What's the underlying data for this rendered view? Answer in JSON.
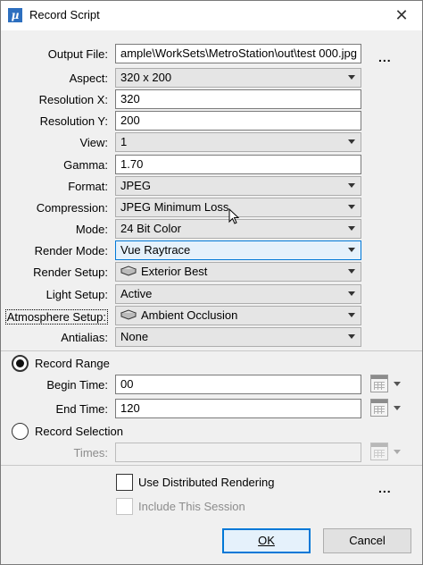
{
  "window": {
    "title": "Record Script",
    "app_icon": "microstation-icon",
    "close_glyph": "✕"
  },
  "labels": {
    "output_file": "Output File:",
    "aspect": "Aspect:",
    "resolution_x": "Resolution X:",
    "resolution_y": "Resolution Y:",
    "view": "View:",
    "gamma": "Gamma:",
    "format": "Format:",
    "compression": "Compression:",
    "mode": "Mode:",
    "render_mode": "Render Mode:",
    "render_setup": "Render Setup:",
    "light_setup": "Light Setup:",
    "atmosphere_setup": "Atmosphere Setup:",
    "antialias": "Antialias:"
  },
  "values": {
    "output_file": "ample\\WorkSets\\MetroStation\\out\\test 000.jpg",
    "aspect": "320 x 200",
    "resolution_x": "320",
    "resolution_y": "200",
    "view": "1",
    "gamma": "1.70",
    "format": "JPEG",
    "compression": "JPEG Minimum Loss",
    "mode": "24 Bit Color",
    "render_mode": "Vue Raytrace",
    "render_setup": "Exterior Best",
    "light_setup": "Active",
    "atmosphere_setup": "Ambient Occlusion",
    "antialias": "None"
  },
  "browse_label": "...",
  "record_range": {
    "label": "Record Range",
    "selected": true,
    "begin_label": "Begin Time:",
    "begin_value": "00",
    "end_label": "End Time:",
    "end_value": "120"
  },
  "record_selection": {
    "label": "Record Selection",
    "selected": false,
    "times_label": "Times:",
    "times_value": ""
  },
  "options": {
    "distributed_label": "Use Distributed Rendering",
    "include_session_label": "Include This Session",
    "more_label": "..."
  },
  "buttons": {
    "ok": "OK",
    "cancel": "Cancel"
  },
  "colors": {
    "accent": "#0078d7",
    "window_bg": "#f0f0f0"
  }
}
